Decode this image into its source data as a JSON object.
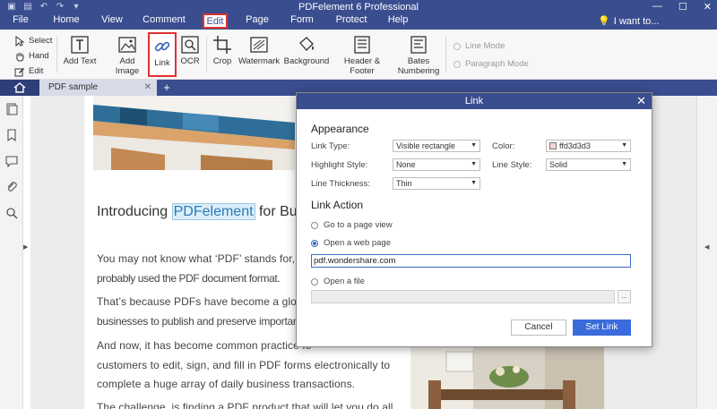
{
  "window": {
    "title": "PDFelement 6 Professional",
    "controls": [
      "—",
      "☐",
      "✕"
    ]
  },
  "menu": {
    "items": [
      "File",
      "Home",
      "View",
      "Comment",
      "Edit",
      "Page",
      "Form",
      "Protect",
      "Help"
    ],
    "active": "Edit",
    "want_to": "I want to..."
  },
  "ribbon": {
    "select": "Select",
    "hand": "Hand",
    "edit": "Edit",
    "add_text": "Add Text",
    "add_image": "Add Image",
    "link": "Link",
    "ocr": "OCR",
    "crop": "Crop",
    "watermark": "Watermark",
    "background": "Background",
    "header_footer": "Header & Footer",
    "bates_numbering_1": "Bates",
    "bates_numbering_2": "Numbering",
    "line_mode": "Line Mode",
    "paragraph_mode": "Paragraph Mode"
  },
  "tabs": {
    "doc_name": "PDF sample",
    "close": "✕",
    "add": "+"
  },
  "document": {
    "heading_pre": "Introducing ",
    "heading_highlight": "PDFelement",
    "heading_post": " for Busi",
    "lines": [
      "You may not know what ‘PDF’ stands for, but",
      "probably used the PDF document format.",
      "That’s because PDFs have become a globa",
      "businesses to publish and preserve importan",
      "And now, it has become common practice fo",
      "customers to edit, sign, and fill in PDF forms electronically to",
      "complete a huge array of daily business transactions.",
      "The challenge, is finding a PDF product that will let you do all"
    ]
  },
  "dialog": {
    "title": "Link",
    "close": "✕",
    "appearance_title": "Appearance",
    "link_type_label": "Link Type:",
    "link_type_value": "Visible rectangle",
    "color_label": "Color:",
    "color_value": "ffd3d3d3",
    "color_swatch": "#ffd3d3",
    "highlight_label": "Highlight Style:",
    "highlight_value": "None",
    "line_style_label": "Line Style:",
    "line_style_value": "Solid",
    "thickness_label": "Line Thickness:",
    "thickness_value": "Thin",
    "action_title": "Link Action",
    "opt_page": "Go to a page view",
    "opt_web": "Open a web page",
    "url_value": "pdf.wondershare.com",
    "opt_file": "Open a file",
    "browse": "...",
    "cancel": "Cancel",
    "set_link": "Set Link"
  },
  "colors": {
    "brand": "#3a4d8f",
    "accent": "#3a6bdc",
    "highlight_border": "#e03232"
  }
}
